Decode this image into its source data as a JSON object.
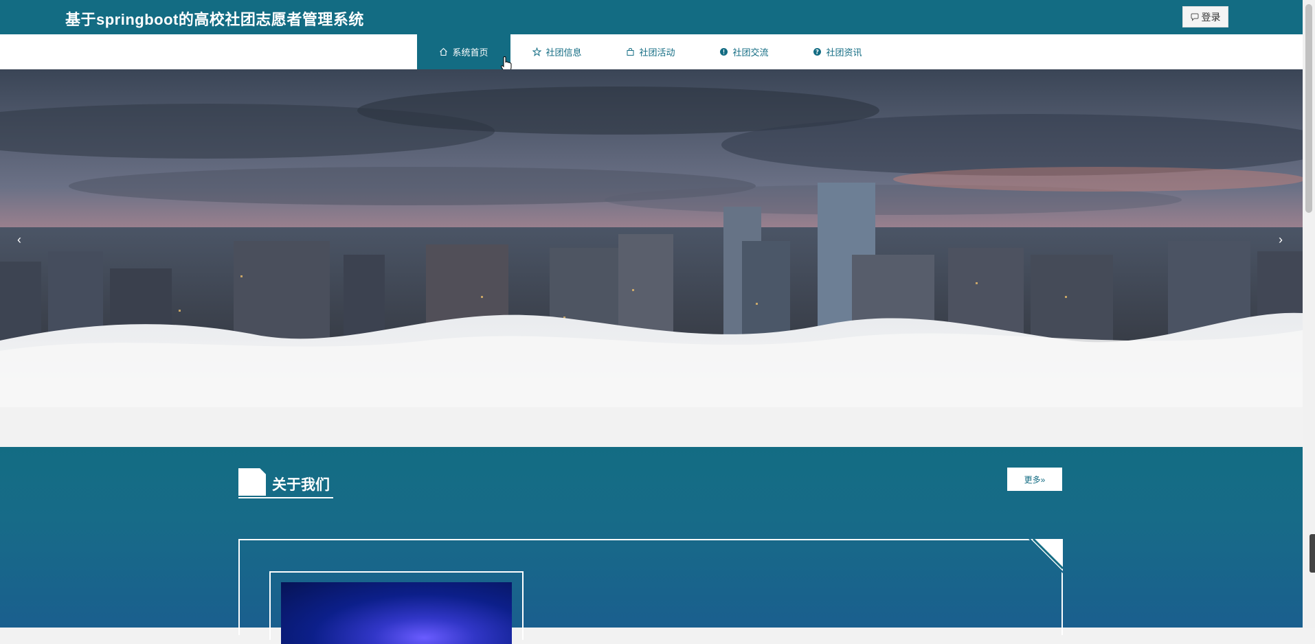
{
  "header": {
    "title": "基于springboot的高校社团志愿者管理系统",
    "login_label": "登录"
  },
  "nav": {
    "items": [
      {
        "label": "系统首页",
        "icon": "home-icon",
        "active": true
      },
      {
        "label": "社团信息",
        "icon": "star-icon",
        "active": false
      },
      {
        "label": "社团活动",
        "icon": "bag-icon",
        "active": false
      },
      {
        "label": "社团交流",
        "icon": "alert-circle-icon",
        "active": false
      },
      {
        "label": "社团资讯",
        "icon": "help-circle-icon",
        "active": false
      }
    ]
  },
  "banner": {
    "prev_label": "‹",
    "next_label": "›"
  },
  "about": {
    "title": "关于我们",
    "more_label": "更多»"
  },
  "colors": {
    "primary": "#136c83",
    "accent_white": "#ffffff"
  }
}
